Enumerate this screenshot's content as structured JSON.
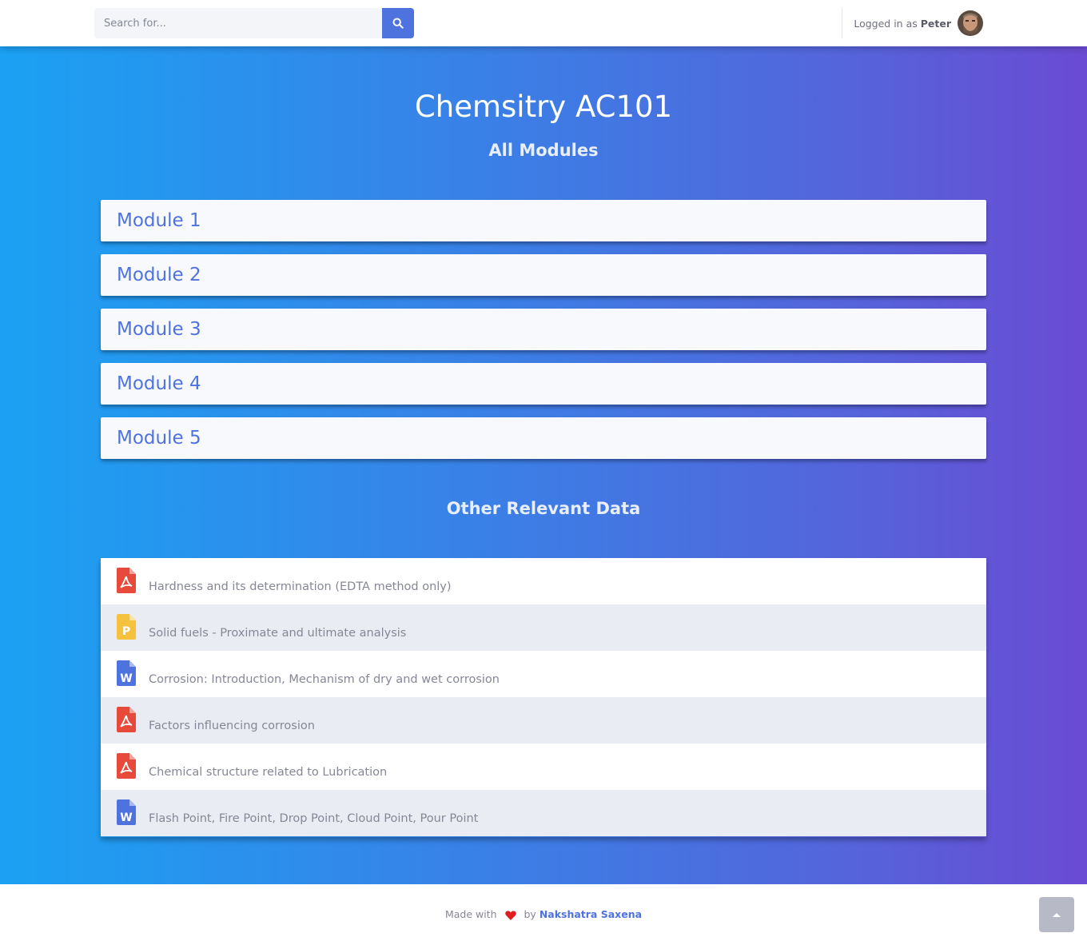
{
  "search": {
    "placeholder": "Search for..."
  },
  "user": {
    "prefix": "Logged in as",
    "name": "Peter"
  },
  "course": {
    "title": "Chemsitry AC101",
    "modules_heading": "All Modules"
  },
  "modules": [
    {
      "label": "Module 1"
    },
    {
      "label": "Module 2"
    },
    {
      "label": "Module 3"
    },
    {
      "label": "Module 4"
    },
    {
      "label": "Module 5"
    }
  ],
  "other": {
    "heading": "Other Relevant Data",
    "files": [
      {
        "name": "Hardness and its determination (EDTA method only)",
        "type": "pdf",
        "color": "#e74a3b"
      },
      {
        "name": "Solid fuels - Proximate and ultimate analysis",
        "type": "ppt",
        "color": "#f6c23e"
      },
      {
        "name": "Corrosion: Introduction, Mechanism of dry and wet corrosion",
        "type": "word",
        "color": "#4e73df"
      },
      {
        "name": "Factors influencing corrosion",
        "type": "pdf",
        "color": "#e74a3b"
      },
      {
        "name": "Chemical structure related to Lubrication",
        "type": "pdf",
        "color": "#e74a3b"
      },
      {
        "name": "Flash Point, Fire Point, Drop Point, Cloud Point, Pour Point",
        "type": "word",
        "color": "#4e73df"
      }
    ]
  },
  "footer": {
    "made_with": "Made with",
    "by": "by",
    "author": "Nakshatra Saxena"
  },
  "icons": {
    "search": "search-icon",
    "heart": "heart-icon",
    "scroll_top": "chevron-up-icon"
  }
}
